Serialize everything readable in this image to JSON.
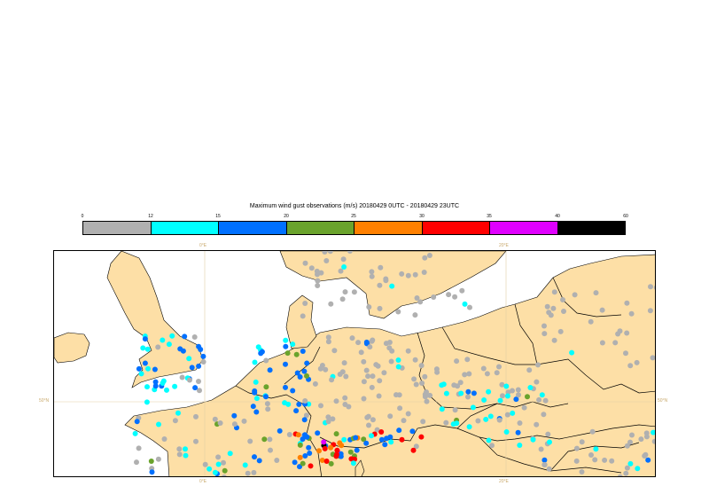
{
  "title": "Maximum wind gust observations (m/s) 20180429 0UTC - 20180429 23UTC",
  "legend": {
    "ticks": [
      "0",
      "12",
      "15",
      "20",
      "25",
      "30",
      "35",
      "40",
      "60"
    ],
    "colors": [
      "#b0b0b0",
      "#00ffff",
      "#0070ff",
      "#6aa32c",
      "#ff8000",
      "#ff0000",
      "#e000ff",
      "#000000"
    ]
  },
  "graticule": {
    "lon_labels": [
      "0°E",
      "20°E"
    ],
    "lat_labels": [
      "50°N"
    ]
  },
  "map_colors": {
    "land": "#fddfa6",
    "sea": "#ffffff",
    "border": "#000000",
    "grid": "#e3cfa3"
  }
}
